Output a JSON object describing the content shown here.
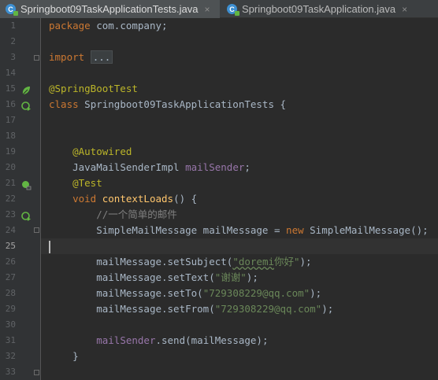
{
  "tabs": [
    {
      "label": "Springboot09TaskApplicationTests.java",
      "active": true
    },
    {
      "label": "Springboot09TaskApplication.java",
      "active": false
    }
  ],
  "close_glyph": "×",
  "line_numbers": [
    "1",
    "2",
    "3",
    "14",
    "15",
    "16",
    "17",
    "18",
    "19",
    "20",
    "21",
    "22",
    "23",
    "24",
    "25",
    "26",
    "27",
    "28",
    "29",
    "30",
    "31",
    "32",
    "33"
  ],
  "code": {
    "l1_kw": "package",
    "l1_rest": " com.company;",
    "l3_kw": "import",
    "l3_fold": "...",
    "l15_ann": "@SpringBootTest",
    "l16_kw": "class",
    "l16_rest": " Springboot09TaskApplicationTests {",
    "l19_ann": "@Autowired",
    "l20_type": "JavaMailSenderImpl",
    "l20_field": "mailSender",
    "l20_end": ";",
    "l21_ann": "@Test",
    "l22_kw": "void",
    "l22_fn": "contextLoads",
    "l22_rest": "() {",
    "l23_cmt": "//一个简单的邮件",
    "l24_a": "SimpleMailMessage mailMessage = ",
    "l24_kw": "new",
    "l24_b": " SimpleMailMessage();",
    "l26_a": "mailMessage.setSubject(",
    "l26_s1": "\"doremi",
    "l26_s2": "你好\"",
    "l26_b": ");",
    "l27_a": "mailMessage.setText(",
    "l27_s": "\"谢谢\"",
    "l27_b": ");",
    "l28_a": "mailMessage.setTo(",
    "l28_s": "\"729308229@qq.com\"",
    "l28_b": ");",
    "l29_a": "mailMessage.setFrom(",
    "l29_s": "\"729308229@qq.com\"",
    "l29_b": ");",
    "l31_field": "mailSender",
    "l31_rest": ".send(mailMessage);",
    "l32": "}"
  },
  "colors": {
    "keyword": "#cc7832",
    "annotation": "#bbb529",
    "string": "#6a8759",
    "field": "#9876aa",
    "function": "#ffc66d"
  },
  "icons": {
    "gutter_spring": "spring-bean-icon",
    "gutter_run": "run-test-icon",
    "tab_file": "java-class-icon"
  }
}
